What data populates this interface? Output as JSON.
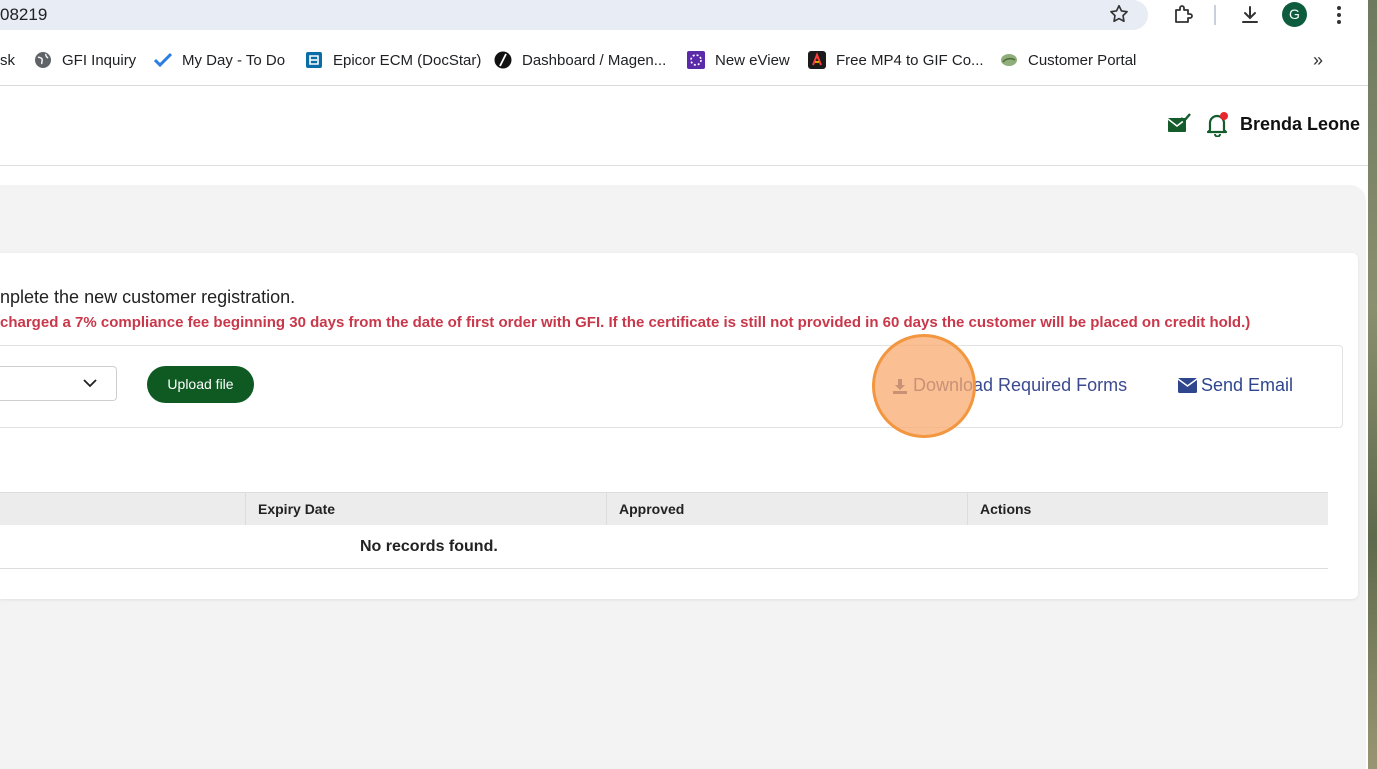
{
  "browser": {
    "url_fragment": "08219",
    "avatar_letter": "G",
    "bookmarks": [
      {
        "label": "sk",
        "icon": "tab-fragment"
      },
      {
        "label": "GFI Inquiry",
        "icon": "globe-icon"
      },
      {
        "label": "My Day - To Do",
        "icon": "checkmark-icon"
      },
      {
        "label": "Epicor ECM (DocStar)",
        "icon": "epicor-icon"
      },
      {
        "label": "Dashboard / Magen...",
        "icon": "magento-icon"
      },
      {
        "label": "New eView",
        "icon": "eview-icon"
      },
      {
        "label": "Free MP4 to GIF Co...",
        "icon": "adobe-icon"
      },
      {
        "label": "Customer Portal",
        "icon": "portal-icon"
      }
    ],
    "more_label": "»"
  },
  "header": {
    "username": "Brenda Leone"
  },
  "main": {
    "intro": "nplete the new customer registration.",
    "notice": "charged a 7% compliance fee beginning 30 days from the date of first order with GFI. If the certificate is still not provided in 60 days the customer will be placed on credit hold.)",
    "upload_button": "Upload file",
    "download_forms": "Download Required Forms",
    "send_email": "Send Email",
    "table": {
      "columns": [
        "Expiry Date",
        "Approved",
        "Actions"
      ],
      "empty_message": "No records found."
    }
  },
  "colors": {
    "primary_green": "#0f5a23",
    "notice_red": "#c8384a",
    "link_blue": "#3c4b8f"
  }
}
